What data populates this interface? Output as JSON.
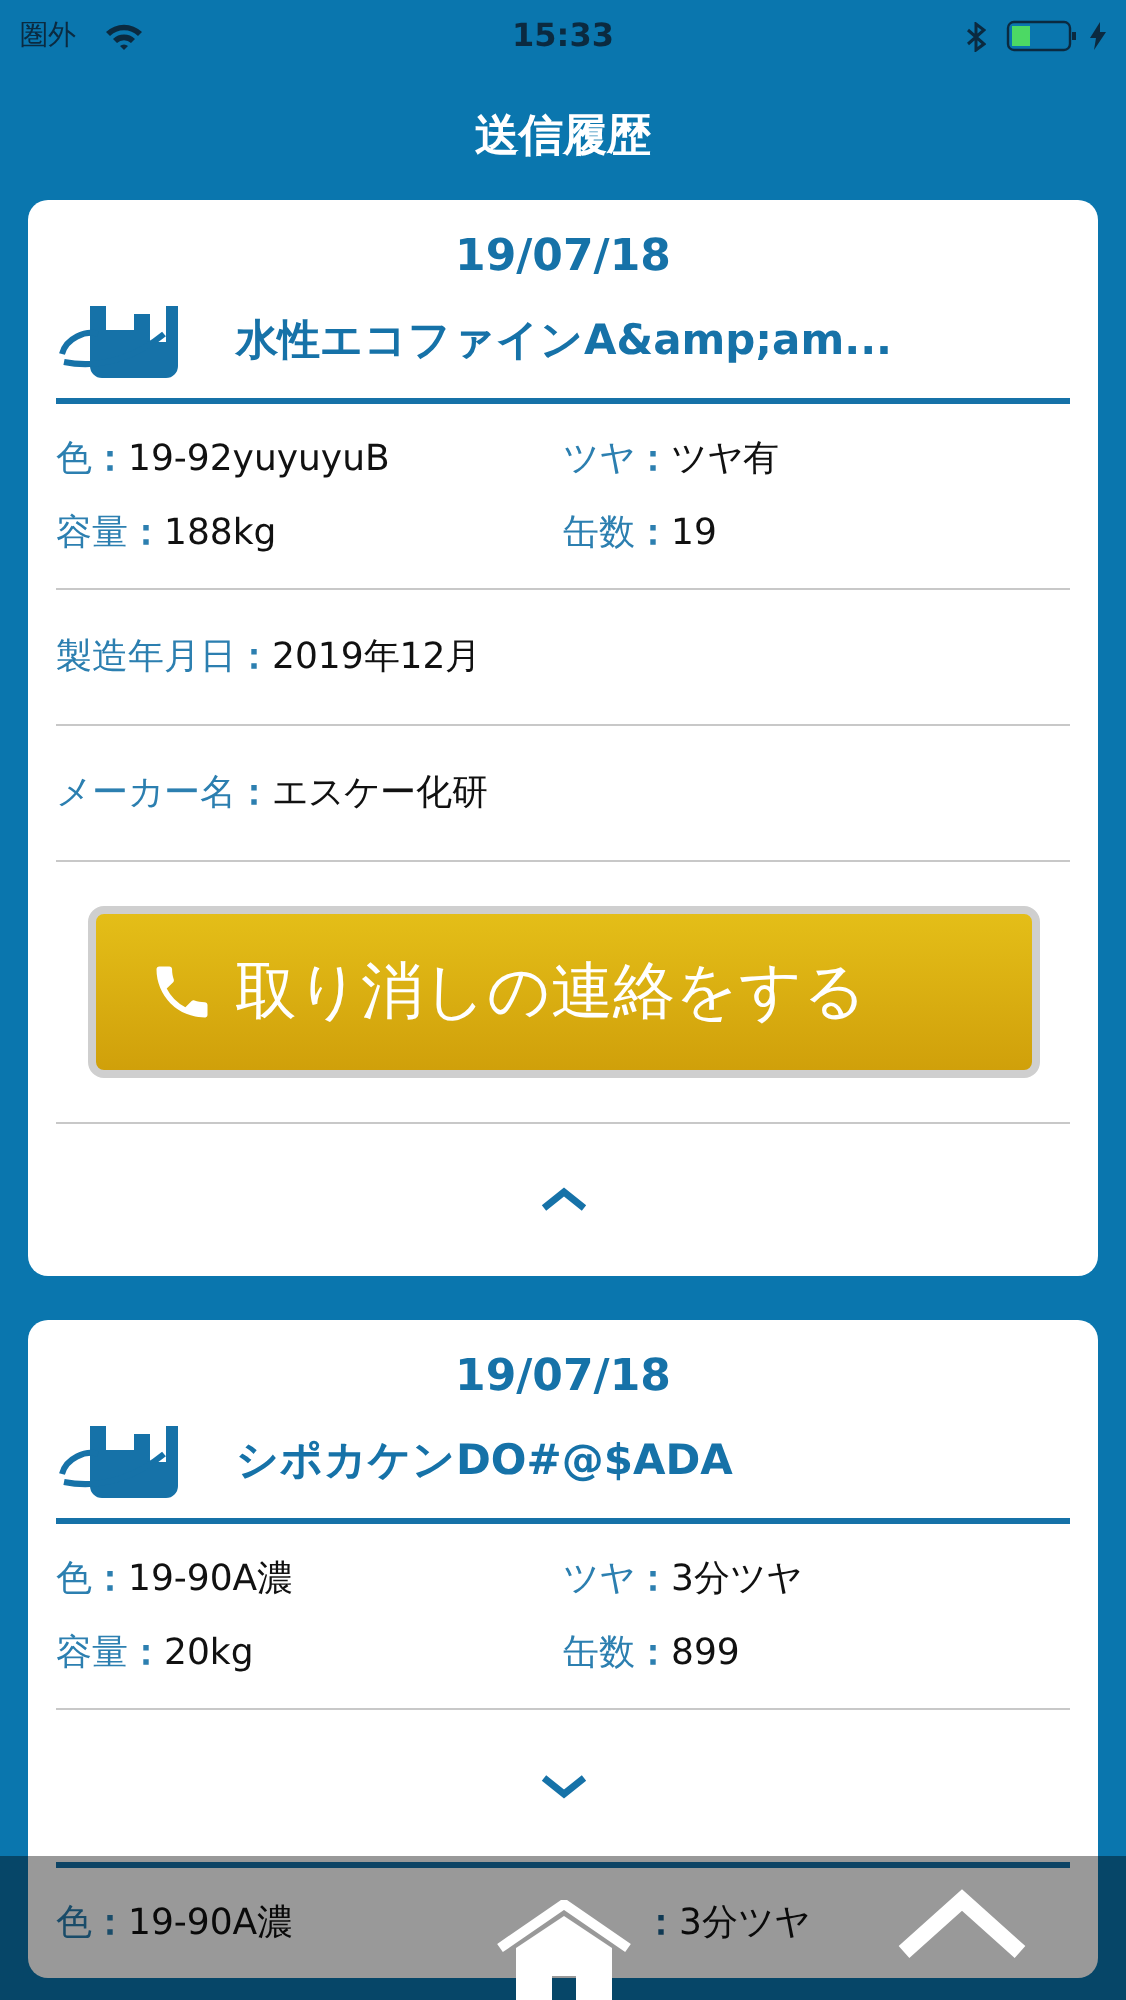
{
  "status_bar": {
    "carrier": "圏外",
    "time": "15:33"
  },
  "header": {
    "title": "送信履歴"
  },
  "cards": [
    {
      "date": "19/07/18",
      "product": "水性エコファインA&amp;am...",
      "specs": [
        {
          "label": "色",
          "separator": "：",
          "value": "19-92yuyuyuB"
        },
        {
          "label": "ツヤ",
          "separator": "：",
          "value": "ツヤ有"
        },
        {
          "label": "容量",
          "separator": "：",
          "value": "188kg"
        },
        {
          "label": "缶数",
          "separator": "：",
          "value": "19"
        }
      ],
      "details": [
        {
          "label": "製造年月日",
          "separator": "：",
          "value": "2019年12月"
        },
        {
          "label": "メーカー名",
          "separator": "：",
          "value": "エスケー化研"
        }
      ],
      "button": "取り消しの連絡をする",
      "expanded": true
    },
    {
      "date": "19/07/18",
      "product": "シポカケンDO#@$ADA",
      "specs": [
        {
          "label": "色",
          "separator": "：",
          "value": "19-90A濃"
        },
        {
          "label": "ツヤ",
          "separator": "：",
          "value": "3分ツヤ"
        },
        {
          "label": "容量",
          "separator": "：",
          "value": "20kg"
        },
        {
          "label": "缶数",
          "separator": "：",
          "value": "899"
        }
      ],
      "expanded": false,
      "cut_off_row": {
        "label": "色",
        "separator": "：",
        "value": "19-90A濃",
        "separator_2": "：",
        "value_2": "3分ツヤ"
      }
    }
  ]
}
